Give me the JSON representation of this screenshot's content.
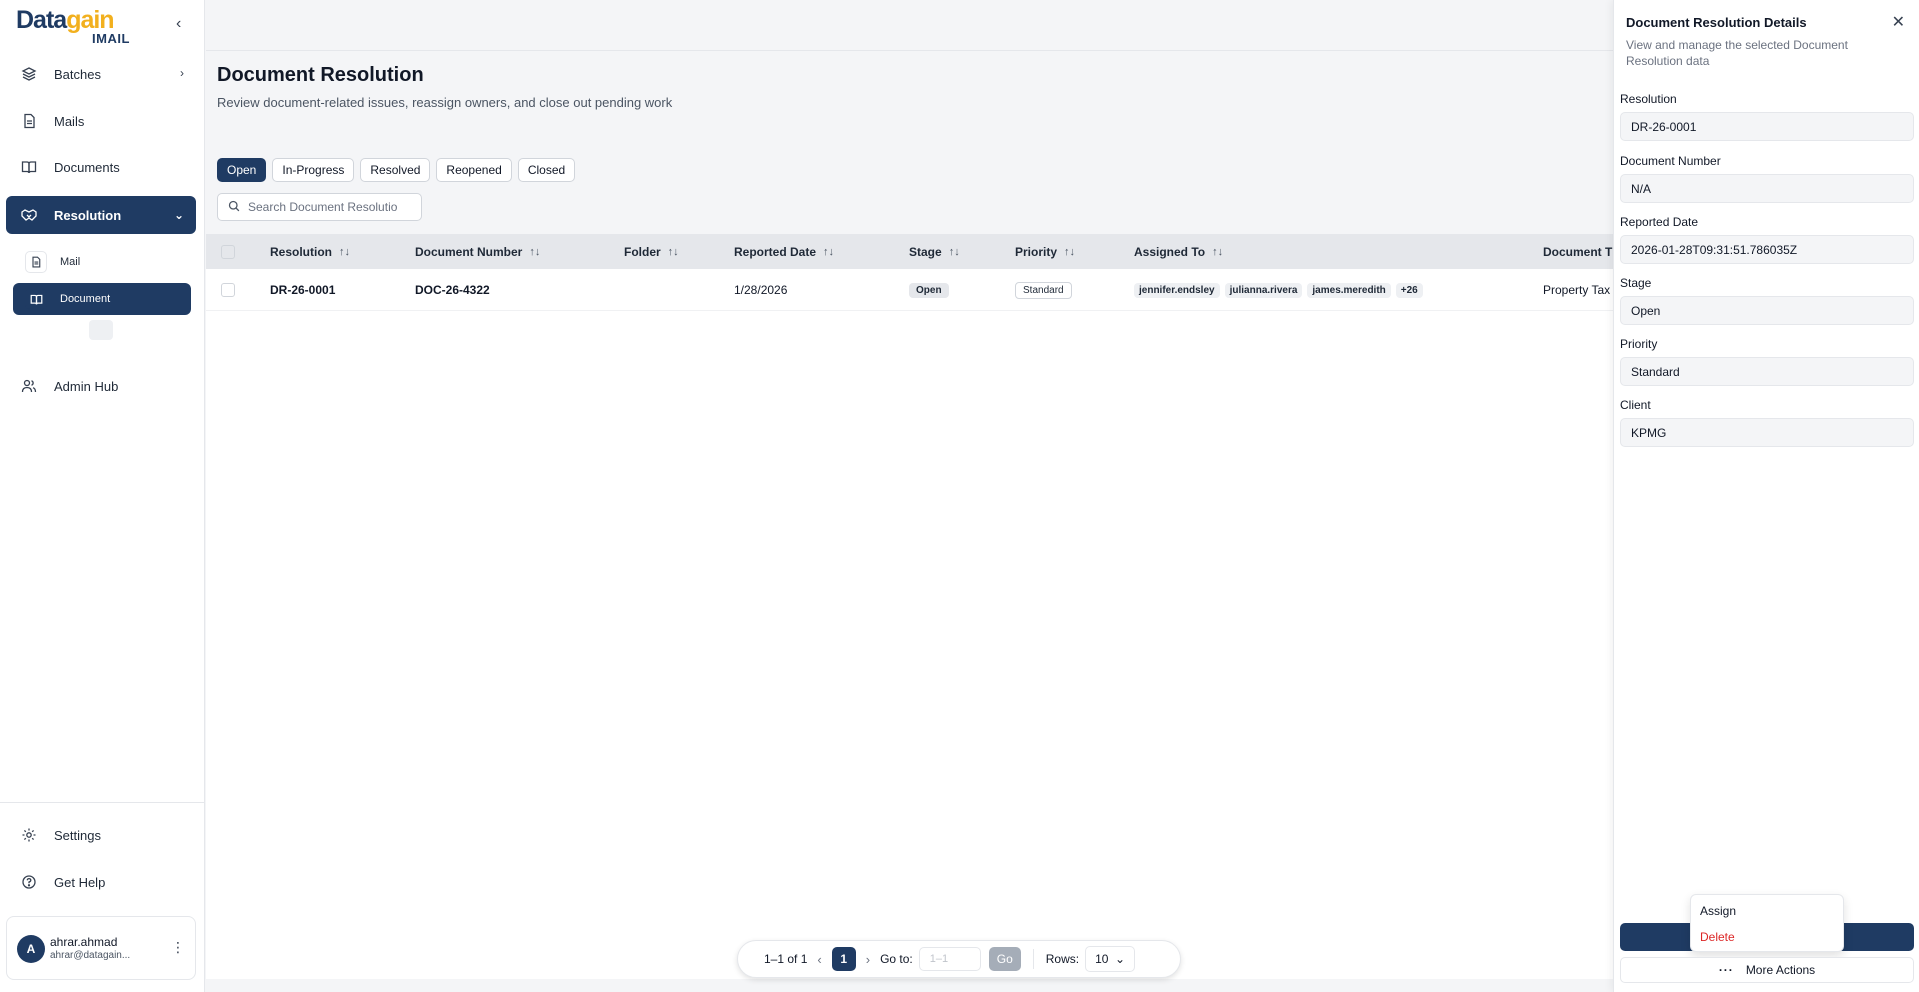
{
  "brand": {
    "logo_main_a": "Data",
    "logo_main_b": "gain",
    "logo_sub": "IMAIL"
  },
  "sidebar": {
    "items": [
      {
        "label": "Batches"
      },
      {
        "label": "Mails"
      },
      {
        "label": "Documents"
      },
      {
        "label": "Resolution"
      },
      {
        "label": "Admin Hub"
      }
    ],
    "subitems": [
      {
        "label": "Mail"
      },
      {
        "label": "Document"
      }
    ],
    "footer": [
      {
        "label": "Settings"
      },
      {
        "label": "Get Help"
      }
    ],
    "user": {
      "initial": "A",
      "name": "ahrar.ahmad",
      "email": "ahrar@datagain..."
    }
  },
  "page": {
    "title": "Document Resolution",
    "subtitle": "Review document-related issues, reassign owners, and close out pending work"
  },
  "tabs": [
    {
      "label": "Open",
      "active": true
    },
    {
      "label": "In-Progress"
    },
    {
      "label": "Resolved"
    },
    {
      "label": "Reopened"
    },
    {
      "label": "Closed"
    }
  ],
  "search": {
    "placeholder": "Search Document Resolution"
  },
  "table": {
    "columns": [
      "Resolution",
      "Document Number",
      "Folder",
      "Reported Date",
      "Stage",
      "Priority",
      "Assigned To",
      "Document T"
    ],
    "rows": [
      {
        "resolution": "DR-26-0001",
        "document_number": "DOC-26-4322",
        "folder": "",
        "reported_date": "1/28/2026",
        "stage": "Open",
        "priority": "Standard",
        "assigned": [
          "jennifer.endsley",
          "julianna.rivera",
          "james.meredith"
        ],
        "assigned_more": "+26",
        "document_type": "Property Tax"
      }
    ]
  },
  "pagination": {
    "range": "1–1 of 1",
    "current_page": "1",
    "goto_label": "Go to:",
    "goto_placeholder": "1–1",
    "go_label": "Go",
    "rows_label": "Rows:",
    "rows_value": "10"
  },
  "panel": {
    "title": "Document Resolution Details",
    "description": "View and manage the selected Document Resolution data",
    "fields": [
      {
        "label": "Resolution",
        "value": "DR-26-0001"
      },
      {
        "label": "Document Number",
        "value": "N/A"
      },
      {
        "label": "Reported Date",
        "value": "2026-01-28T09:31:51.786035Z"
      },
      {
        "label": "Stage",
        "value": "Open"
      },
      {
        "label": "Priority",
        "value": "Standard"
      },
      {
        "label": "Client",
        "value": "KPMG"
      }
    ],
    "menu": [
      {
        "label": "Assign"
      },
      {
        "label": "Delete"
      }
    ],
    "more_actions_label": "More Actions"
  },
  "colors": {
    "primary": "#1f3b63",
    "accent_yellow": "#f2b01e",
    "danger": "#dc2626"
  }
}
